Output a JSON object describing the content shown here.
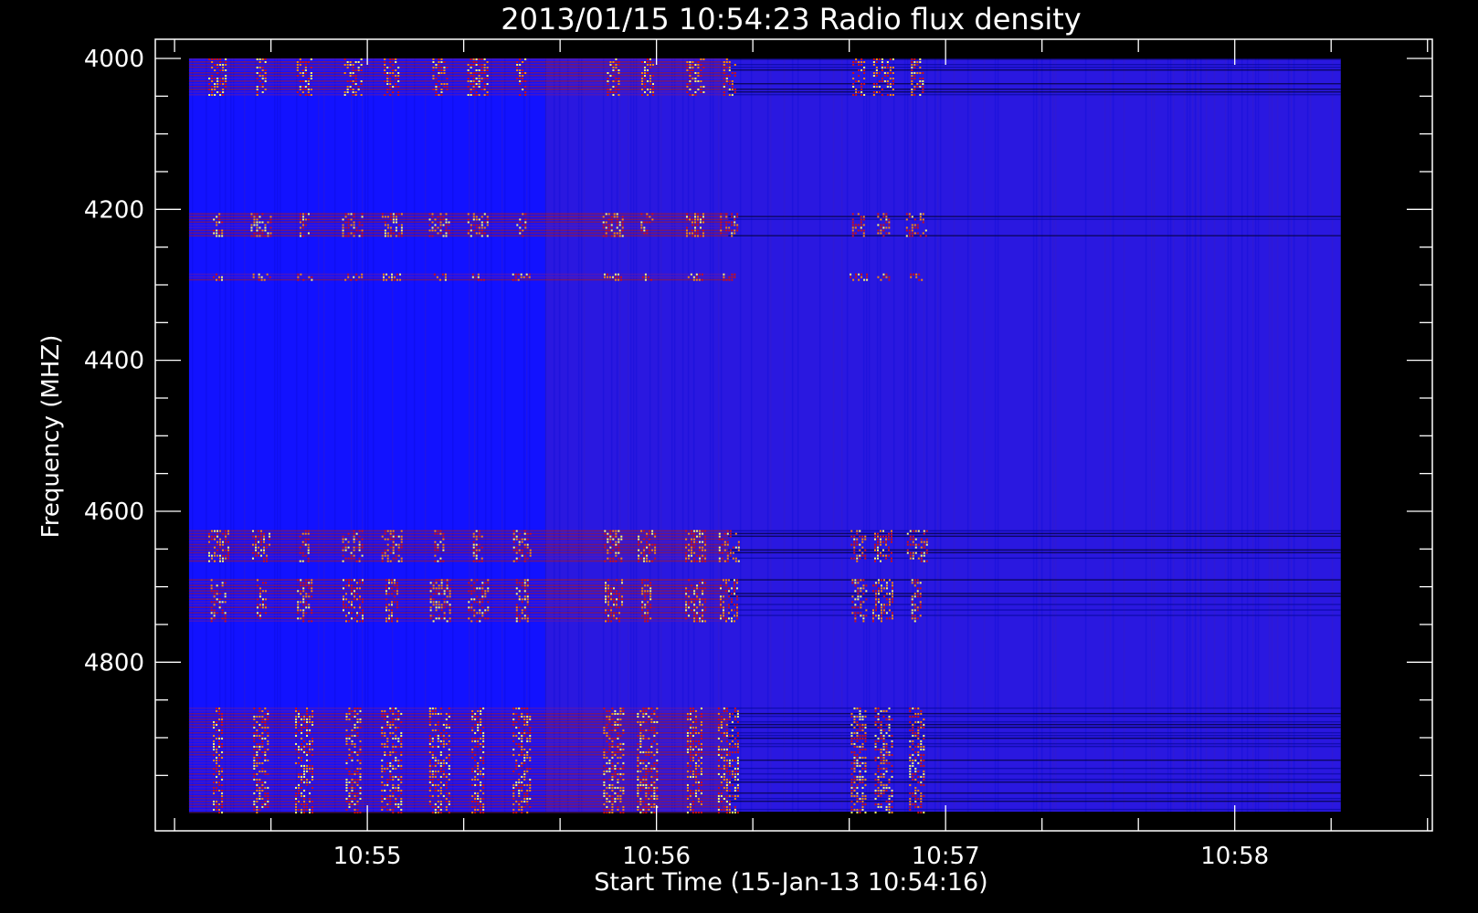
{
  "chart_data": {
    "type": "heatmap",
    "title": "2013/01/15 10:54:23 Radio flux density",
    "xlabel": "Start Time (15-Jan-13 10:54:16)",
    "ylabel": "Frequency (MHZ)",
    "xlim": [
      "10:54:16",
      "10:58:41"
    ],
    "ylim": [
      4000,
      4998
    ],
    "data_extent": {
      "x": [
        "10:54:23",
        "10:58:22"
      ],
      "y": [
        4000,
        4998
      ]
    },
    "x_ticks": [
      "10:55",
      "10:56",
      "10:57",
      "10:58"
    ],
    "y_ticks": [
      4000,
      4200,
      4400,
      4600,
      4800
    ],
    "colormap": [
      "#000000",
      "#1010ff",
      "#5a1fc8",
      "#c01818",
      "#ff7000",
      "#ffff60"
    ],
    "background_level": {
      "before": "#1212ff",
      "after": "#2a18e0",
      "change_time": "10:55:37"
    },
    "emission_bands_mhz": [
      [
        4000,
        4050
      ],
      [
        4205,
        4235
      ],
      [
        4285,
        4295
      ],
      [
        4625,
        4665
      ],
      [
        4690,
        4745
      ],
      [
        4860,
        4998
      ]
    ],
    "burst_times": [
      "10:54:29",
      "10:54:38",
      "10:54:47",
      "10:54:57",
      "10:55:05",
      "10:55:15",
      "10:55:23",
      "10:55:32",
      "10:55:51",
      "10:55:58",
      "10:56:08",
      "10:56:15",
      "10:56:42",
      "10:56:47",
      "10:56:54"
    ]
  }
}
